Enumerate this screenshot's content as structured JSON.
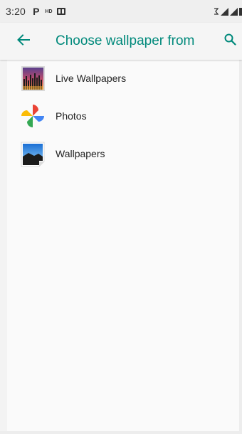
{
  "status_bar": {
    "time": "3:20",
    "p_label": "P",
    "hd_label": "HD"
  },
  "app_bar": {
    "title": "Choose wallpaper from",
    "back_icon": "arrow-back-icon",
    "search_icon": "search-icon",
    "accent_color": "#00897b"
  },
  "wallpaper_sources": [
    {
      "label": "Live Wallpapers",
      "icon": "live-wallpapers-icon"
    },
    {
      "label": "Photos",
      "icon": "photos-pinwheel-icon"
    },
    {
      "label": "Wallpapers",
      "icon": "wallpapers-landscape-icon"
    }
  ]
}
